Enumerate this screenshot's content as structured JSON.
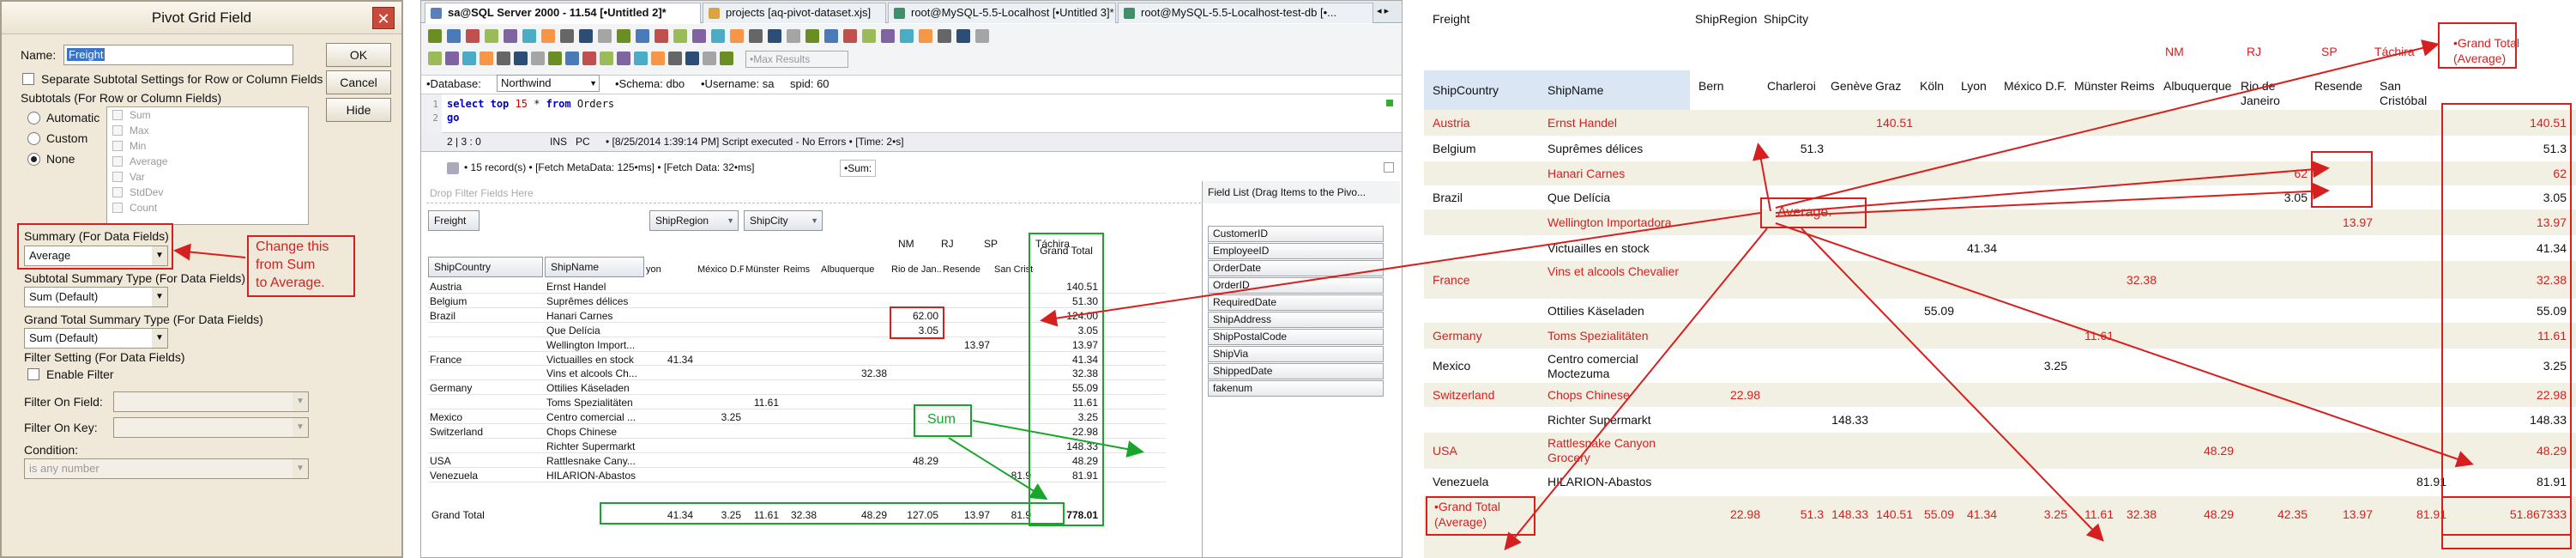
{
  "dialog": {
    "title": "Pivot Grid Field",
    "close": "✕",
    "name_label": "Name:",
    "name_value": "Freight",
    "separate_subtotal": "Separate Subtotal Settings for Row or Column Fields",
    "subtotals_label": "Subtotals (For Row or Column Fields)",
    "radio_automatic": "Automatic",
    "radio_custom": "Custom",
    "radio_none": "None",
    "subtotal_list": [
      "Sum",
      "Max",
      "Min",
      "Average",
      "Var",
      "StdDev",
      "Count"
    ],
    "ok": "OK",
    "cancel": "Cancel",
    "hide": "Hide",
    "summary_label": "Summary (For Data Fields)",
    "summary_value": "Average",
    "subtotal_summary_label": "Subtotal Summary Type (For Data Fields)",
    "subtotal_summary_value": "Sum (Default)",
    "grand_total_summary_label": "Grand Total Summary Type (For Data Fields)",
    "grand_total_summary_value": "Sum (Default)",
    "filter_setting_label": "Filter Setting (For Data Fields)",
    "enable_filter": "Enable Filter",
    "filter_on_field": "Filter On Field:",
    "filter_on_key": "Filter On Key:",
    "condition_label": "Condition:",
    "condition_value": "is any number",
    "annotation": [
      "Change this",
      "from Sum",
      "to Average."
    ]
  },
  "sql": {
    "tabs": [
      "sa@SQL Server 2000 - 11.54 [•Untitled 2]*",
      "projects [aq-pivot-dataset.xjs]",
      "root@MySQL-5.5-Localhost [•Untitled 3]*",
      "root@MySQL-5.5-Localhost-test-db [•..."
    ],
    "tab_arrows": "◂ ▸",
    "max_results_placeholder": "•Max Results",
    "database_label": "•Database:",
    "database_value": "Northwind",
    "schema_label": "•Schema: dbo",
    "username_label": "•Username: sa",
    "spid_label": "spid: 60",
    "editor_line1_kw1": "select",
    "editor_line1_kw2": "top",
    "editor_line1_num": "15",
    "editor_line1_star": "*",
    "editor_line1_kw3": "from",
    "editor_line1_tbl": "Orders",
    "editor_line2": "go",
    "gutter": [
      "1",
      "2"
    ],
    "status_pos": "2 | 3 : 0",
    "status_ins": "INS",
    "status_pc": "PC",
    "status_msg": "• [8/25/2014 1:39:14 PM] Script executed - No Errors • [Time: 2•s]",
    "result_info": "• 15 record(s) • [Fetch MetaData: 125•ms] • [Fetch Data: 32•ms]",
    "result_sum": "•Sum:",
    "drop_filter": "Drop Filter Fields Here",
    "freight_btn": "Freight",
    "shipregion_btn": "ShipRegion",
    "shipcity_btn": "ShipCity",
    "shipcountry_btn": "ShipCountry",
    "shipname_btn": "ShipName",
    "region_headers": [
      "NM",
      "RJ",
      "SP",
      "Táchira"
    ],
    "grand_total_header": "Grand Total",
    "city_headers": [
      "yon",
      "México D.F.",
      "Münster",
      "Reims",
      "Albuquerque",
      "Rio de Jan...",
      "Resende",
      "San Cristó..."
    ],
    "rows": [
      {
        "country": "Austria",
        "name": "Ernst Handel",
        "gt": "140.51"
      },
      {
        "country": "Belgium",
        "name": "Suprêmes délices",
        "gt": "51.30"
      },
      {
        "country": "Brazil",
        "name": "Hanari Carnes",
        "gt": "124.00"
      },
      {
        "country": "",
        "name": "Que Delícia",
        "gt": "3.05"
      },
      {
        "country": "",
        "name": "Wellington Import...",
        "gt": "13.97"
      },
      {
        "country": "France",
        "name": "Victuailles en stock",
        "gt": "41.34"
      },
      {
        "country": "",
        "name": "Vins et alcools Ch...",
        "gt": "32.38"
      },
      {
        "country": "Germany",
        "name": "Ottilies Käseladen",
        "gt": "55.09"
      },
      {
        "country": "",
        "name": "Toms Spezialitäten",
        "gt": "11.61"
      },
      {
        "country": "Mexico",
        "name": "Centro comercial ...",
        "gt": "3.25"
      },
      {
        "country": "Switzerland",
        "name": "Chops Chinese",
        "gt": "22.98"
      },
      {
        "country": "",
        "name": "Richter Supermarkt",
        "gt": "148.33"
      },
      {
        "country": "USA",
        "name": "Rattlesnake Cany...",
        "gt": "48.29"
      },
      {
        "country": "Venezuela",
        "name": "HILARION-Abastos",
        "gt": "81.91"
      }
    ],
    "inner_values": {
      "brazil_a": "62.00",
      "brazil_b": "3.05",
      "well": "13.97",
      "vict": "41.34",
      "vins": "32.38",
      "toms": "11.61",
      "centro": "3.25",
      "ratt": "48.29",
      "hil": "81.9"
    },
    "grand_total_label": "Grand Total",
    "grand_total_values": [
      "41.34",
      "3.25",
      "11.61",
      "32.38",
      "48.29",
      "127.05",
      "13.97",
      "81.9"
    ],
    "grand_total_total": "778.01",
    "field_list_title": "Field List (Drag Items to the Pivo...",
    "field_list": [
      "CustomerID",
      "EmployeeID",
      "OrderDate",
      "OrderID",
      "RequiredDate",
      "ShipAddress",
      "ShipPostalCode",
      "ShipVia",
      "ShippedDate",
      "fakenum"
    ],
    "sum_annotation": "Sum"
  },
  "pivot": {
    "freight": "Freight",
    "shipregion": "ShipRegion",
    "shipcity": "ShipCity",
    "regions": [
      "NM",
      "RJ",
      "SP",
      "Táchira"
    ],
    "grand_total_header": [
      "•Grand Total",
      "(Average)"
    ],
    "shipcountry": "ShipCountry",
    "shipname": "ShipName",
    "cities": [
      "Bern",
      "Charleroi",
      "Genève",
      "Graz",
      "Köln",
      "Lyon",
      "México D.F.",
      "Münster",
      "Reims",
      "Albuquerque",
      "Rio de Janeiro",
      "Resende",
      "San Cristóbal"
    ],
    "rows": [
      {
        "country": "Austria",
        "name": "Ernst Handel",
        "graz": "140.51",
        "gt": "140.51",
        "red": true
      },
      {
        "country": "Belgium",
        "name": "Suprêmes délices",
        "charleroi": "51.3",
        "gt": "51.3",
        "red": false
      },
      {
        "country": "",
        "name": "Hanari Carnes",
        "rio": "62",
        "gt": "62",
        "red": true
      },
      {
        "country": "Brazil",
        "name": "Que Delícia",
        "rio": "3.05",
        "gt": "3.05",
        "red": false
      },
      {
        "country": "",
        "name": "Wellington Importadora",
        "resende": "13.97",
        "gt": "13.97",
        "red": true
      },
      {
        "country": "",
        "name": "Victuailles en stock",
        "lyon": "41.34",
        "gt": "41.34",
        "red": false
      },
      {
        "country": "France",
        "name": "Vins et alcools Chevalier",
        "reims": "32.38",
        "gt": "32.38",
        "red": true
      },
      {
        "country": "",
        "name": "Ottilies Käseladen",
        "koln": "55.09",
        "gt": "55.09",
        "red": false
      },
      {
        "country": "Germany",
        "name": "Toms Spezialitäten",
        "munster": "11.61",
        "gt": "11.61",
        "red": true
      },
      {
        "country": "Mexico",
        "name": "Centro comercial Moctezuma",
        "mexico": "3.25",
        "gt": "3.25",
        "red": false
      },
      {
        "country": "Switzerland",
        "name": "Chops Chinese",
        "bern": "22.98",
        "gt": "22.98",
        "red": true
      },
      {
        "country": "",
        "name": "Richter Supermarkt",
        "geneve": "148.33",
        "gt": "148.33",
        "red": false
      },
      {
        "country": "USA",
        "name": "Rattlesnake Canyon Grocery",
        "albuq": "48.29",
        "gt": "48.29",
        "red": true
      },
      {
        "country": "Venezuela",
        "name": "HILARION-Abastos",
        "sancris": "81.91",
        "gt": "81.91",
        "red": false
      }
    ],
    "grand_total_row_label": [
      "•Grand Total",
      "(Average)"
    ],
    "grand_total_row": [
      "22.98",
      "51.3",
      "148.33",
      "140.51",
      "55.09",
      "41.34",
      "3.25",
      "11.61",
      "32.38",
      "48.29",
      "42.35",
      "13.97",
      "81.91",
      "51.867333"
    ],
    "average_annotation": "Average."
  },
  "colors": {
    "red_annotation": "#d62020",
    "green_annotation": "#17a52a",
    "band_alt": "#f2f0e2",
    "header_blue": "#dbe6f5"
  }
}
